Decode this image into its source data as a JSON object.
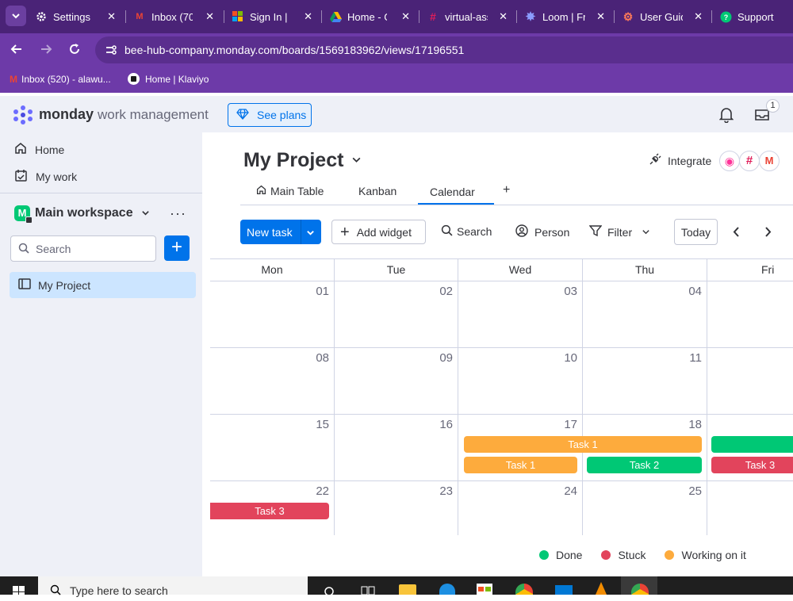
{
  "browser": {
    "tabs": [
      {
        "title": "Settings",
        "icon": "gear-icon"
      },
      {
        "title": "Inbox (70",
        "icon": "gmail-icon"
      },
      {
        "title": "Sign In | M",
        "icon": "microsoft-icon"
      },
      {
        "title": "Home - G",
        "icon": "google-drive-icon"
      },
      {
        "title": "virtual-ass",
        "icon": "slack-icon"
      },
      {
        "title": "Loom | Fre",
        "icon": "loom-icon"
      },
      {
        "title": "User Guid",
        "icon": "hubspot-icon"
      },
      {
        "title": "Support",
        "icon": "support-icon"
      }
    ],
    "url": "bee-hub-company.monday.com/boards/1569183962/views/17196551",
    "bookmarks": [
      {
        "label": "Inbox (520) - alawu...",
        "icon": "gmail-icon"
      },
      {
        "label": "Home | Klaviyo",
        "icon": "klaviyo-icon"
      }
    ]
  },
  "app": {
    "brand": "monday",
    "product": "work management",
    "see_plans": "See plans",
    "inbox_badge": "1"
  },
  "sidebar": {
    "home": "Home",
    "my_work": "My work",
    "workspace": "Main workspace",
    "workspace_initial": "M",
    "search_placeholder": "Search",
    "add": "+",
    "project": "My Project"
  },
  "board": {
    "title": "My Project",
    "integrate": "Integrate",
    "tabs": [
      "Main Table",
      "Kanban",
      "Calendar"
    ],
    "add_tab": "+",
    "toolbar": {
      "new_task": "New task",
      "add_widget": "Add widget",
      "search": "Search",
      "person": "Person",
      "filter": "Filter",
      "today": "Today"
    },
    "days": [
      "Mon",
      "Tue",
      "Wed",
      "Thu",
      "Fri"
    ],
    "weeks": [
      [
        "01",
        "02",
        "03",
        "04",
        ""
      ],
      [
        "08",
        "09",
        "10",
        "11",
        ""
      ],
      [
        "15",
        "16",
        "17",
        "18",
        ""
      ],
      [
        "22",
        "23",
        "24",
        "25",
        ""
      ]
    ],
    "tasks": {
      "t1_span": "Task 1",
      "t1_wed": "Task 1",
      "t2_thu": "Task 2",
      "t3_fri": "Task 3",
      "t3_mon": "Task 3"
    },
    "legend": [
      {
        "label": "Done",
        "color": "#00c875"
      },
      {
        "label": "Stuck",
        "color": "#e2445c"
      },
      {
        "label": "Working on it",
        "color": "#fdab3d"
      }
    ]
  },
  "taskbar": {
    "search_placeholder": "Type here to search"
  },
  "colors": {
    "primary": "#0073ea",
    "done": "#00c875",
    "stuck": "#e2445c",
    "working": "#fdab3d"
  }
}
